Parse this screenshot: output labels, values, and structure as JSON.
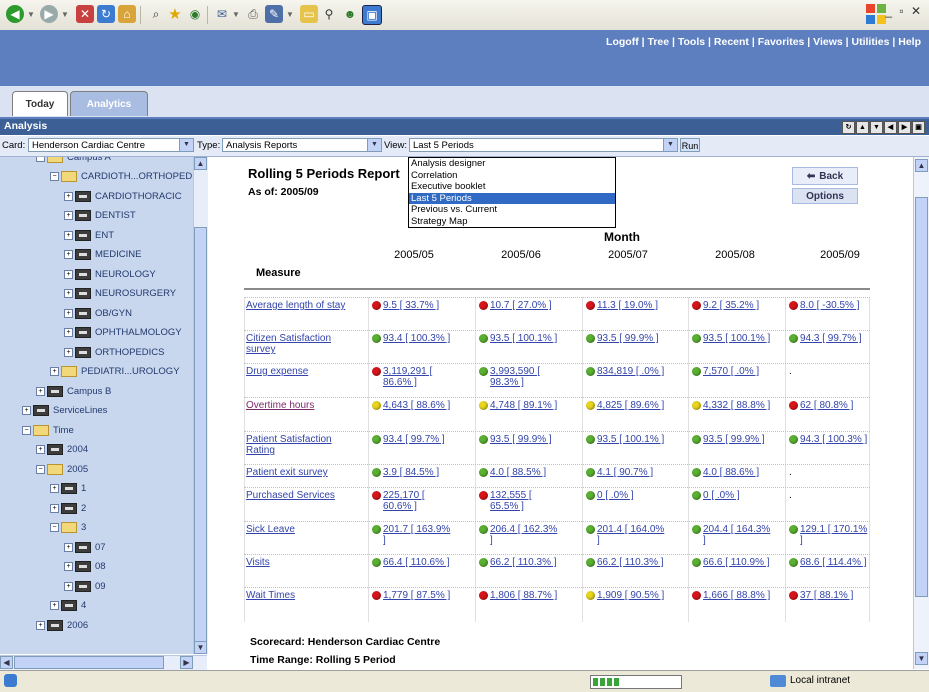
{
  "header": {
    "links": [
      "Logoff",
      "Tree",
      "Tools",
      "Recent",
      "Favorites",
      "Views",
      "Utilities",
      "Help"
    ]
  },
  "tabs": [
    "Today",
    "Analytics"
  ],
  "analysis_bar": {
    "title": "Analysis"
  },
  "filters": {
    "card_label": "Card:",
    "card_value": "Henderson Cardiac Centre",
    "type_label": "Type:",
    "type_value": "Analysis Reports",
    "view_label": "View:",
    "view_value": "Last 5 Periods",
    "run_label": "Run"
  },
  "view_menu": [
    "Analysis designer",
    "Correlation",
    "Executive booklet",
    "Last 5 Periods",
    "Previous vs. Current",
    "Strategy Map"
  ],
  "view_menu_selected": "Last 5 Periods",
  "tree": [
    {
      "label": "Campus A",
      "indent": 1,
      "icon": "open"
    },
    {
      "label": "CARDIOTH...ORTHOPED",
      "indent": 2,
      "icon": "open"
    },
    {
      "label": "CARDIOTHORACIC",
      "indent": 3,
      "icon": "dark"
    },
    {
      "label": "DENTIST",
      "indent": 3,
      "icon": "dark"
    },
    {
      "label": "ENT",
      "indent": 3,
      "icon": "dark"
    },
    {
      "label": "MEDICINE",
      "indent": 3,
      "icon": "dark"
    },
    {
      "label": "NEUROLOGY",
      "indent": 3,
      "icon": "dark"
    },
    {
      "label": "NEUROSURGERY",
      "indent": 3,
      "icon": "dark"
    },
    {
      "label": "OB/GYN",
      "indent": 3,
      "icon": "dark"
    },
    {
      "label": "OPHTHALMOLOGY",
      "indent": 3,
      "icon": "dark"
    },
    {
      "label": "ORTHOPEDICS",
      "indent": 3,
      "icon": "dark"
    },
    {
      "label": "PEDIATRI...UROLOGY",
      "indent": 2,
      "icon": "yel"
    },
    {
      "label": "Campus B",
      "indent": 1,
      "icon": "dark"
    },
    {
      "label": "ServiceLines",
      "indent": 0,
      "icon": "dark"
    },
    {
      "label": "Time",
      "indent": 0,
      "icon": "open"
    },
    {
      "label": "2004",
      "indent": 1,
      "icon": "dark"
    },
    {
      "label": "2005",
      "indent": 1,
      "icon": "open"
    },
    {
      "label": "1",
      "indent": 2,
      "icon": "dark"
    },
    {
      "label": "2",
      "indent": 2,
      "icon": "dark"
    },
    {
      "label": "3",
      "indent": 2,
      "icon": "open"
    },
    {
      "label": "07",
      "indent": 3,
      "icon": "dark"
    },
    {
      "label": "08",
      "indent": 3,
      "icon": "dark"
    },
    {
      "label": "09",
      "indent": 3,
      "icon": "dark"
    },
    {
      "label": "4",
      "indent": 2,
      "icon": "dark"
    },
    {
      "label": "2006",
      "indent": 1,
      "icon": "dark"
    }
  ],
  "report": {
    "title": "Rolling 5 Periods Report",
    "as_of": "As of: 2005/09",
    "back_label": "Back",
    "options_label": "Options",
    "month_label": "Month",
    "measure_header": "Measure",
    "periods": [
      "2005/05",
      "2005/06",
      "2005/07",
      "2005/08",
      "2005/09"
    ],
    "scorecard": "Scorecard: Henderson Cardiac Centre",
    "time_range": "Time Range: Rolling 5 Period"
  },
  "rows": [
    {
      "measure": "Average length of stay",
      "cells": [
        {
          "status": "red",
          "text": "9.5 [ 33.7% ]"
        },
        {
          "status": "red",
          "text": "10.7 [ 27.0% ]"
        },
        {
          "status": "red",
          "text": "11.3 [ 19.0% ]"
        },
        {
          "status": "red",
          "text": "9.2 [ 35.2% ]"
        },
        {
          "status": "red",
          "text": "8.0 [ -30.5% ]"
        }
      ]
    },
    {
      "measure": "Citizen Satisfaction survey",
      "cells": [
        {
          "status": "green",
          "text": "93.4 [ 100.3% ]"
        },
        {
          "status": "green",
          "text": "93.5 [ 100.1% ]"
        },
        {
          "status": "green",
          "text": "93.5 [ 99.9% ]"
        },
        {
          "status": "green",
          "text": "93.5 [ 100.1% ]"
        },
        {
          "status": "green",
          "text": "94.3 [ 99.7% ]"
        }
      ]
    },
    {
      "measure": "Drug expense",
      "cells": [
        {
          "status": "red",
          "text": "3,119,291 [ 86.6% ]"
        },
        {
          "status": "green",
          "text": "3,993,590 [ 98.3% ]"
        },
        {
          "status": "green",
          "text": "834,819 [ .0% ]"
        },
        {
          "status": "green",
          "text": "7,570 [ .0% ]"
        },
        {
          "status": "none",
          "text": "."
        }
      ]
    },
    {
      "measure": "Overtime hours",
      "visited": true,
      "cells": [
        {
          "status": "yellow",
          "text": "4,643 [ 88.6% ]"
        },
        {
          "status": "yellow",
          "text": "4,748 [ 89.1% ]"
        },
        {
          "status": "yellow",
          "text": "4,825 [ 89.6% ]"
        },
        {
          "status": "yellow",
          "text": "4,332 [ 88.8% ]"
        },
        {
          "status": "red",
          "text": "62 [ 80.8% ]"
        }
      ]
    },
    {
      "measure": "Patient Satisfaction Rating",
      "cells": [
        {
          "status": "green",
          "text": "93.4 [ 99.7% ]"
        },
        {
          "status": "green",
          "text": "93.5 [ 99.9% ]"
        },
        {
          "status": "green",
          "text": "93.5 [ 100.1% ]"
        },
        {
          "status": "green",
          "text": "93.5 [ 99.9% ]"
        },
        {
          "status": "green",
          "text": "94.3 [ 100.3% ]"
        }
      ]
    },
    {
      "measure": "Patient exit survey",
      "cells": [
        {
          "status": "green",
          "text": "3.9 [ 84.5% ]"
        },
        {
          "status": "green",
          "text": "4.0 [ 88.5% ]"
        },
        {
          "status": "green",
          "text": "4.1 [ 90.7% ]"
        },
        {
          "status": "green",
          "text": "4.0 [ 88.6% ]"
        },
        {
          "status": "none",
          "text": "."
        }
      ]
    },
    {
      "measure": "Purchased Services",
      "cells": [
        {
          "status": "red",
          "text": "225,170 [ 60.6% ]"
        },
        {
          "status": "red",
          "text": "132,555 [ 65.5% ]"
        },
        {
          "status": "green",
          "text": "0 [ .0% ]"
        },
        {
          "status": "green",
          "text": "0 [ .0% ]"
        },
        {
          "status": "none",
          "text": "."
        }
      ]
    },
    {
      "measure": "Sick Leave",
      "cells": [
        {
          "status": "green",
          "text": "201.7 [ 163.9% ]"
        },
        {
          "status": "green",
          "text": "206.4 [ 162.3% ]"
        },
        {
          "status": "green",
          "text": "201.4 [ 164.0% ]"
        },
        {
          "status": "green",
          "text": "204.4 [ 164.3% ]"
        },
        {
          "status": "green",
          "text": "129.1 [ 170.1% ]"
        }
      ]
    },
    {
      "measure": "Visits",
      "cells": [
        {
          "status": "green",
          "text": "66.4 [ 110.6% ]"
        },
        {
          "status": "green",
          "text": "66.2 [ 110.3% ]"
        },
        {
          "status": "green",
          "text": "66.2 [ 110.3% ]"
        },
        {
          "status": "green",
          "text": "66.6 [ 110.9% ]"
        },
        {
          "status": "green",
          "text": "68.6 [ 114.4% ]"
        }
      ]
    },
    {
      "measure": "Wait Times",
      "cells": [
        {
          "status": "red",
          "text": "1,779 [ 87.5% ]"
        },
        {
          "status": "red",
          "text": "1,806 [ 88.7% ]"
        },
        {
          "status": "yellow",
          "text": "1,909 [ 90.5% ]"
        },
        {
          "status": "red",
          "text": "1,666 [ 88.8% ]"
        },
        {
          "status": "red",
          "text": "37 [ 88.1% ]"
        }
      ]
    }
  ],
  "statusbar": {
    "zone": "Local intranet"
  },
  "colors": {
    "header": "#5d7fbf",
    "tree_bg": "#c8d6ee",
    "red": "#d8151b",
    "green": "#5ab030",
    "yellow": "#e8d51c",
    "link": "#3344aa"
  }
}
